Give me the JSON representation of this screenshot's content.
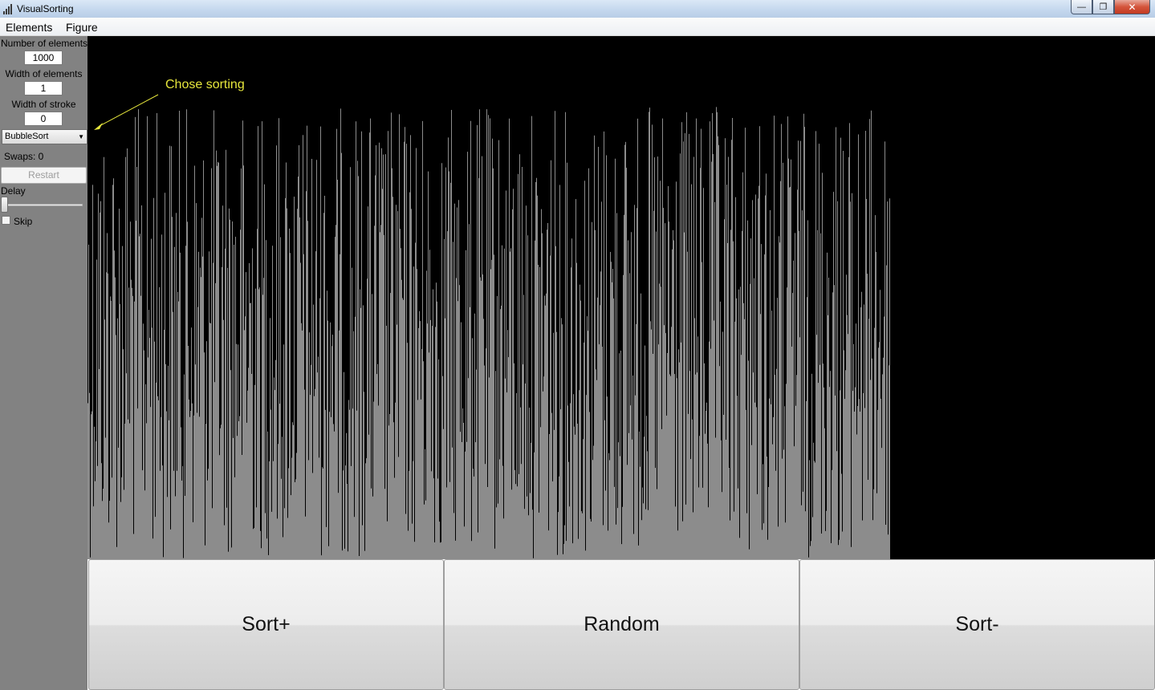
{
  "window": {
    "title": "VisualSorting",
    "min_glyph": "—",
    "max_glyph": "❐",
    "close_glyph": "✕"
  },
  "menu": {
    "items": [
      "Elements",
      "Figure"
    ]
  },
  "panel": {
    "num_elements_label": "Number of elements",
    "num_elements_value": "1000",
    "width_elements_label": "Width of elements",
    "width_elements_value": "1",
    "width_stroke_label": "Width of stroke",
    "width_stroke_value": "0",
    "algorithm_selected": "BubbleSort",
    "swaps_text": "Swaps: 0",
    "restart_label": "Restart",
    "delay_label": "Delay",
    "delay_value": 0,
    "skip_label": "Skip",
    "skip_checked": false
  },
  "annotation": {
    "text": "Chose sorting",
    "color": "#e6e63c"
  },
  "visualization": {
    "element_count": 1000,
    "bar_color": "#ffffff",
    "background": "#000000"
  },
  "buttons": {
    "sort_asc": "Sort+",
    "random": "Random",
    "sort_desc": "Sort-"
  }
}
